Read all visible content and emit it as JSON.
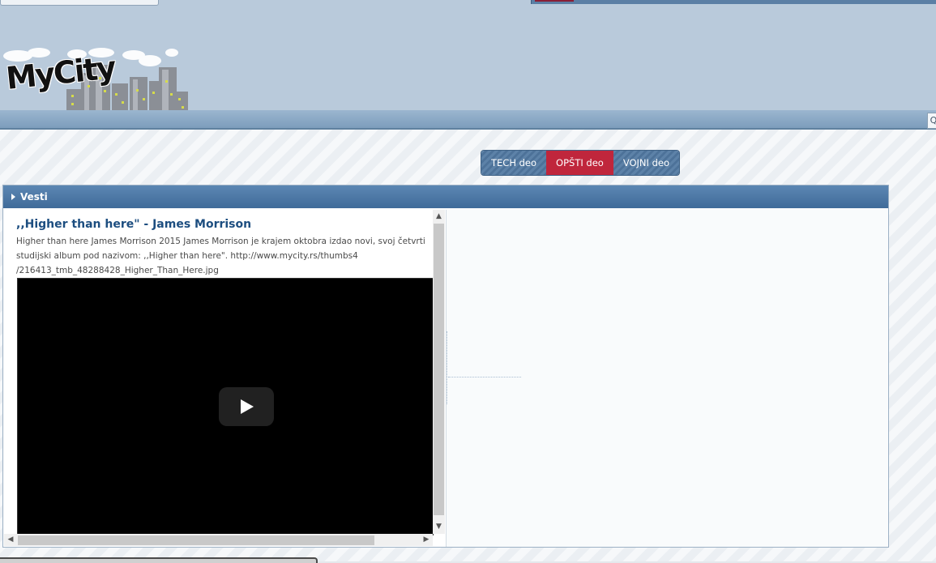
{
  "header": {
    "logo_text": "MyCity",
    "search_glyph": "Q"
  },
  "section_tabs": [
    {
      "label": "TECH deo",
      "active": false
    },
    {
      "label": "OPŠTI deo",
      "active": true
    },
    {
      "label": "VOJNI deo",
      "active": false
    }
  ],
  "panel": {
    "title": "Vesti",
    "article": {
      "title": ",,Higher than here\" - James Morrison",
      "text": "Higher than here James Morrison 2015 James Morrison je krajem oktobra izdao novi, svoj četvrti studijski album pod nazivom: ,,Higher than here\". http://www.mycity.rs/thumbs4 /216413_tmb_48288428_Higher_Than_Here.jpg"
    },
    "scroll_arrows": {
      "up": "▲",
      "down": "▼",
      "left": "◀",
      "right": "▶"
    }
  },
  "colors": {
    "header_bg": "#b9cadb",
    "tab_active": "#c0263c",
    "tab_inactive": "#5d82a8",
    "panel_header": "#4a76a5",
    "article_title": "#1d4e80"
  },
  "icons": {
    "panel_header": "triangle-right-icon",
    "video": "play-icon",
    "search": "search-icon"
  }
}
